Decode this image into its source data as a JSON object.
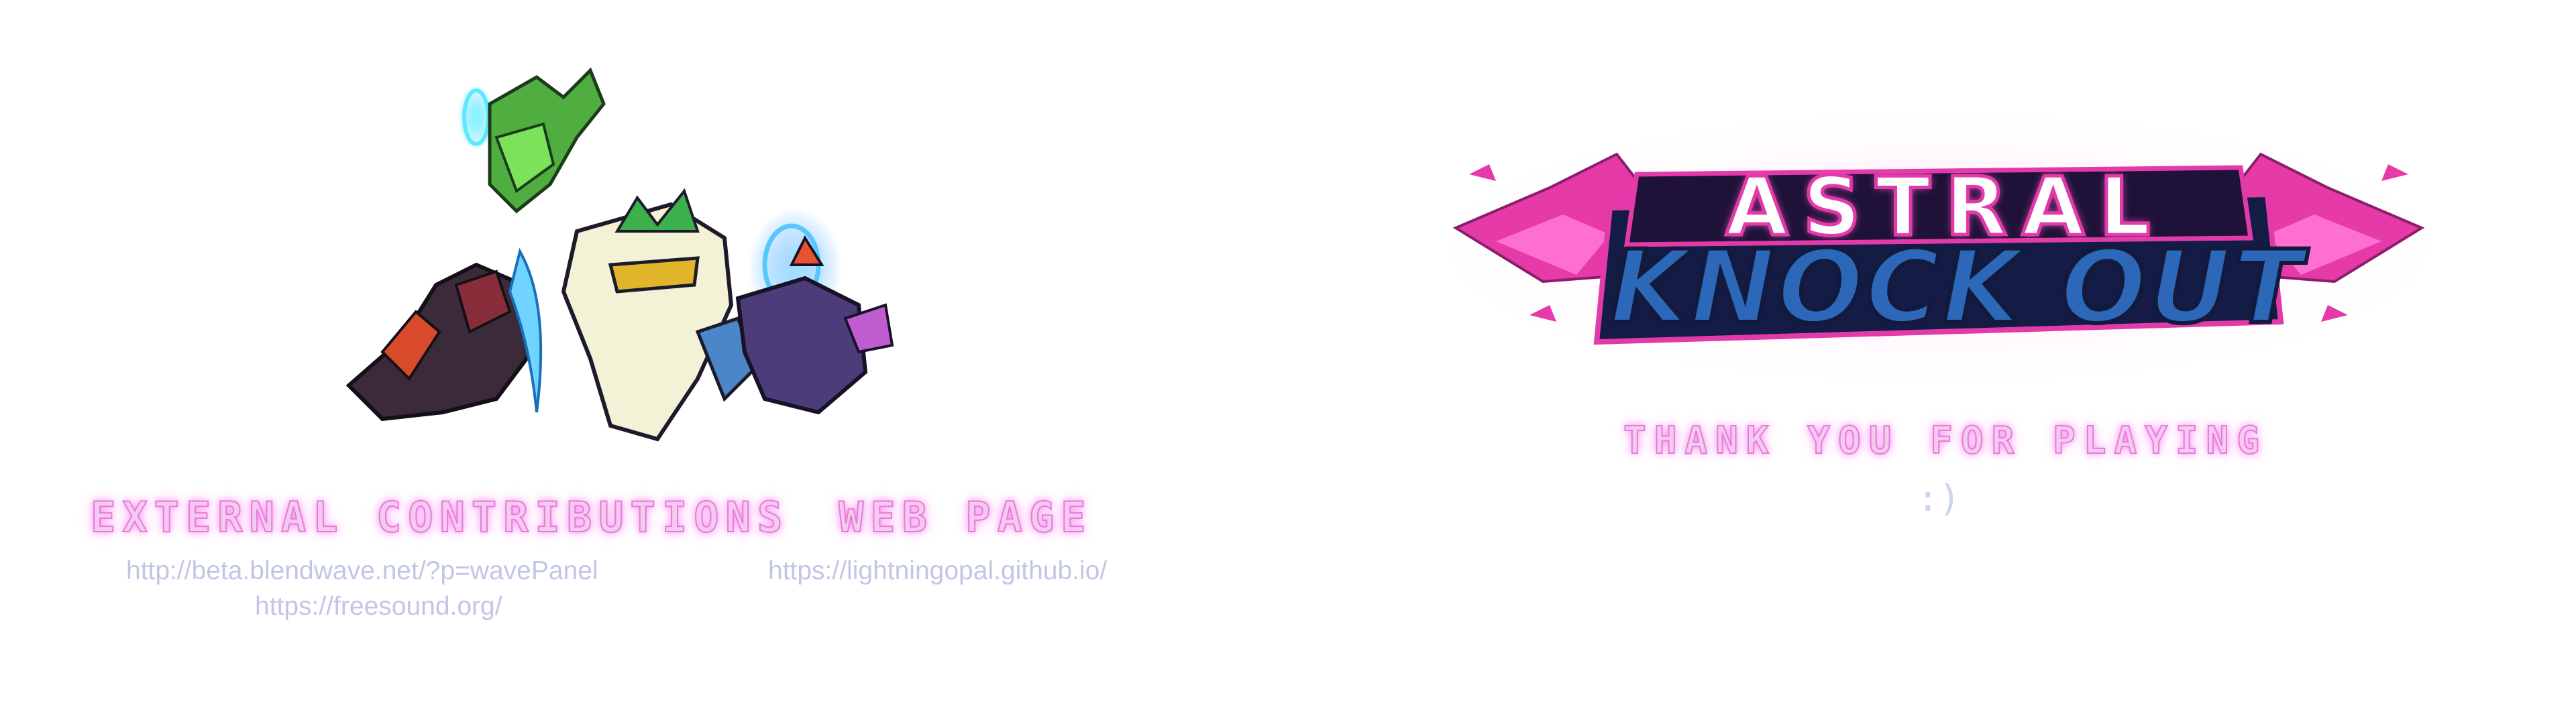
{
  "credits": {
    "external_contributions": {
      "heading": "EXTERNAL CONTRIBUTIONS",
      "links": [
        "http://beta.blendwave.net/?p=wavePanel",
        "https://freesound.org/"
      ]
    },
    "web_page": {
      "heading": "WEB PAGE",
      "links": [
        "https://lightningopal.github.io/"
      ]
    }
  },
  "logo": {
    "line1": "ASTRAL",
    "line2": "KNOCK OUT"
  },
  "message": {
    "thanks": "THANK YOU FOR PLAYING",
    "smiley": ":)"
  },
  "colors": {
    "heading_glow": "#e77bdc",
    "link_text": "#c2c6e6",
    "logo_pink": "#e23aa9",
    "logo_blue": "#2d67b8",
    "logo_navy": "#121a3e"
  }
}
